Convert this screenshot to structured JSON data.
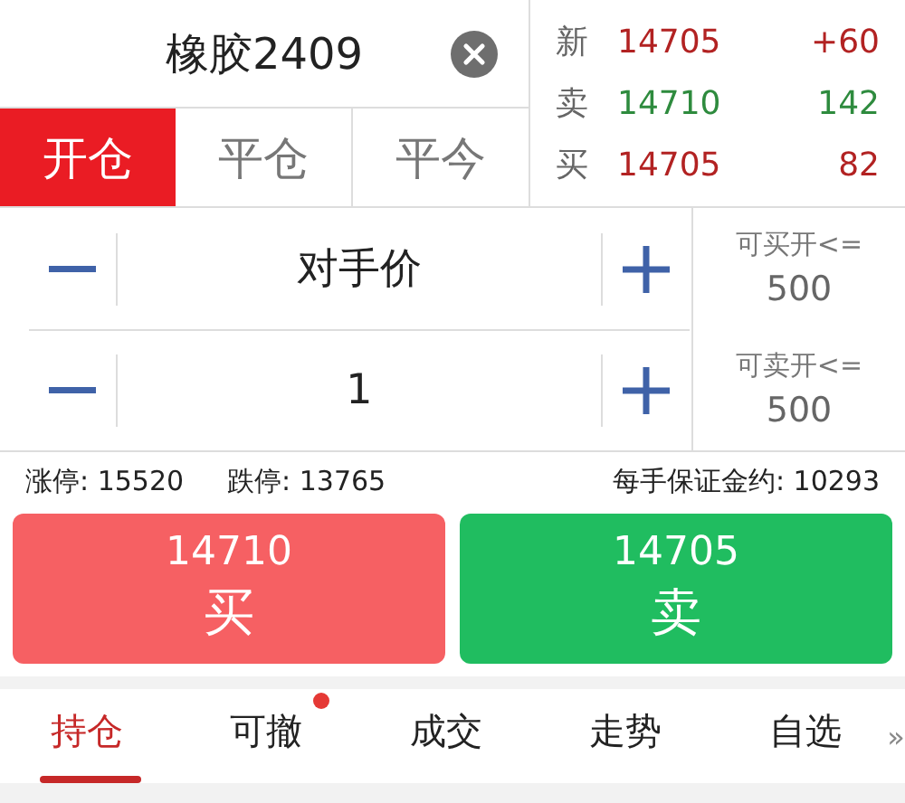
{
  "contract": {
    "name": "橡胶2409"
  },
  "order_tabs": [
    {
      "label": "开仓",
      "selected": true
    },
    {
      "label": "平仓",
      "selected": false
    },
    {
      "label": "平今",
      "selected": false
    }
  ],
  "quotes": [
    {
      "label": "新",
      "price": "14705",
      "value": "+60",
      "color": "#b22222"
    },
    {
      "label": "卖",
      "price": "14710",
      "value": "142",
      "color": "#2e8b3e"
    },
    {
      "label": "买",
      "price": "14705",
      "value": "82",
      "color": "#b22222"
    }
  ],
  "price_field": {
    "value": "对手价",
    "limit_label": "可买开<=",
    "limit_value": "500"
  },
  "quantity_field": {
    "value": "1",
    "limit_label": "可卖开<=",
    "limit_value": "500"
  },
  "info": {
    "upper_limit": "涨停: 15520",
    "lower_limit": "跌停: 13765",
    "margin": "每手保证金约: 10293"
  },
  "buy_button": {
    "price": "14710",
    "label": "买"
  },
  "sell_button": {
    "price": "14705",
    "label": "卖"
  },
  "bottom_tabs": [
    {
      "label": "持仓",
      "selected": true,
      "badge": false
    },
    {
      "label": "可撤",
      "selected": false,
      "badge": true
    },
    {
      "label": "成交",
      "selected": false,
      "badge": false
    },
    {
      "label": "走势",
      "selected": false,
      "badge": false
    },
    {
      "label": "自选",
      "selected": false,
      "badge": false
    }
  ],
  "more": "»"
}
